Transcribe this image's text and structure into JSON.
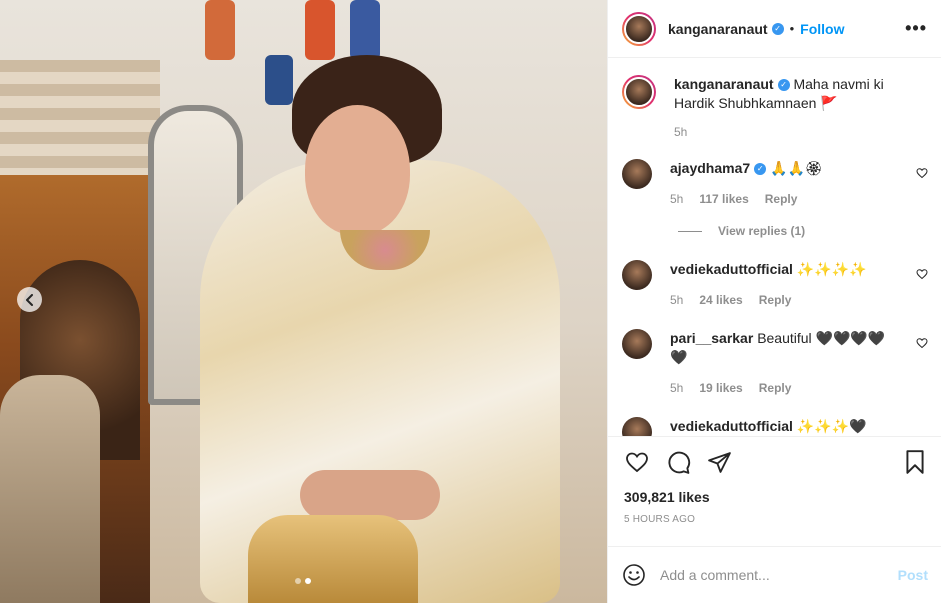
{
  "post": {
    "nav_prev_icon": "chevron-left-icon",
    "carousel_dots": 2,
    "carousel_active": 1
  },
  "header": {
    "username": "kanganaranaut",
    "follow_label": "Follow",
    "bullet": "•",
    "more_icon": "more-horizontal-icon"
  },
  "caption": {
    "username": "kanganaranaut",
    "text": "Maha navmi ki Hardik Shubhkamnaen 🚩",
    "time": "5h"
  },
  "comments": [
    {
      "username": "ajaydhama7",
      "verified": true,
      "text": "🙏🙏🏵",
      "time": "5h",
      "likes": "117 likes",
      "reply_label": "Reply",
      "view_replies": "View replies (1)"
    },
    {
      "username": "vediekaduttofficial",
      "verified": false,
      "text": "✨✨✨✨",
      "time": "5h",
      "likes": "24 likes",
      "reply_label": "Reply"
    },
    {
      "username": "pari__sarkar",
      "verified": false,
      "text": "Beautiful 🖤🖤🖤🖤🖤",
      "time": "5h",
      "likes": "19 likes",
      "reply_label": "Reply"
    },
    {
      "username": "vediekaduttofficial",
      "verified": false,
      "text": "✨✨✨🖤",
      "time": "",
      "likes": "",
      "reply_label": ""
    }
  ],
  "actions": {
    "like_icon": "heart-icon",
    "comment_icon": "comment-icon",
    "share_icon": "share-icon",
    "save_icon": "bookmark-icon",
    "likes_count": "309,821 likes",
    "time_ago": "5 HOURS AGO"
  },
  "add_comment": {
    "emoji_icon": "emoji-icon",
    "placeholder": "Add a comment...",
    "post_label": "Post"
  },
  "colors": {
    "link": "#0095f6",
    "verified": "#3897f0",
    "muted": "#8e8e8e",
    "post_disabled": "#b2dffc"
  }
}
